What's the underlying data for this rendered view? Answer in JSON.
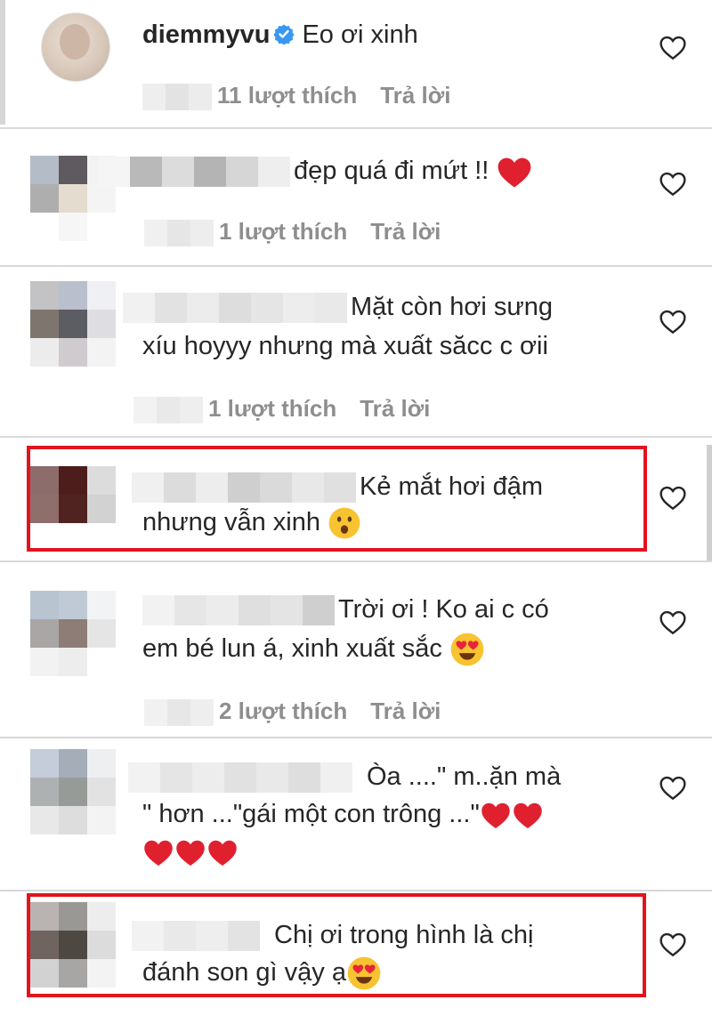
{
  "comments": [
    {
      "username": "diemmyvu",
      "verified": true,
      "text_lines": [
        "Eo ơi xinh"
      ],
      "likes": "11 lượt thích",
      "reply": "Trả lời"
    },
    {
      "text_lines": [
        "đẹp quá đi mứt !!"
      ],
      "likes": "1 lượt thích",
      "reply": "Trả lời"
    },
    {
      "text_lines": [
        "Mặt còn hơi sưng",
        "xíu hoyyy nhưng mà xuất săcc c ơii"
      ],
      "likes": "1 lượt thích",
      "reply": "Trả lời"
    },
    {
      "text_lines": [
        "Kẻ mắt hơi đậm",
        "nhưng vẫn xinh"
      ],
      "highlighted": true
    },
    {
      "text_lines": [
        "Trời ơi ! Ko ai c có",
        "em bé lun á, xinh xuất sắc"
      ],
      "likes": "2 lượt thích",
      "reply": "Trả lời"
    },
    {
      "text_lines": [
        "Òa ....\" m..ặn mà",
        "\" hơn ...\"gái một con trông ...\""
      ]
    },
    {
      "text_lines": [
        "Chị ơi trong hình là chị",
        "đánh son gì vậy ạ"
      ],
      "highlighted": true
    }
  ],
  "icons": {
    "like": "heart-outline-icon",
    "verified": "verified-badge-icon",
    "emoji_heart": "red-heart-emoji",
    "emoji_surprised": "astonished-face-emoji",
    "emoji_heart_eyes": "heart-eyes-emoji"
  },
  "colors": {
    "highlight": "#e2141e",
    "verified": "#3897f0",
    "meta_text": "#8e8e8e",
    "text": "#262626",
    "heart_emoji": "#e0202e"
  }
}
